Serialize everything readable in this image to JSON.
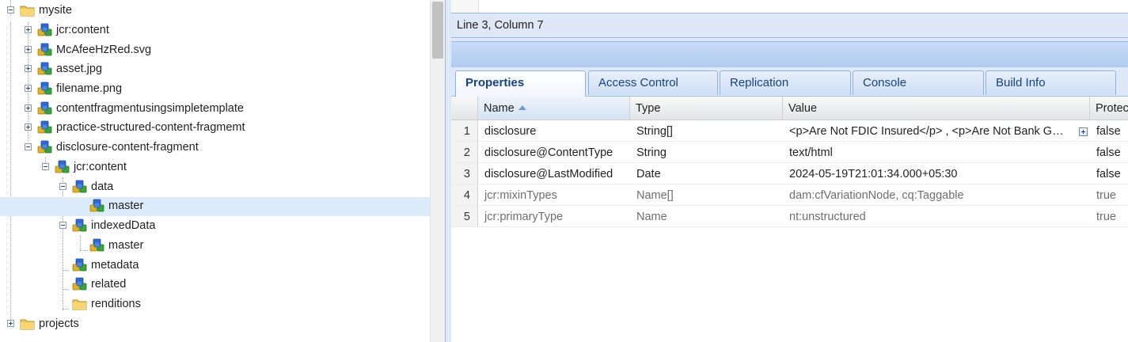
{
  "tree": {
    "nodes": [
      {
        "label": "mysite",
        "icon": "folder-icon",
        "toggle": "minus"
      },
      {
        "label": "jcr:content",
        "icon": "node-icon",
        "toggle": "plus"
      },
      {
        "label": "McAfeeHzRed.svg",
        "icon": "node-icon",
        "toggle": "plus"
      },
      {
        "label": "asset.jpg",
        "icon": "node-icon",
        "toggle": "plus"
      },
      {
        "label": "filename.png",
        "icon": "node-icon",
        "toggle": "plus"
      },
      {
        "label": "contentfragmentusingsimpletemplate",
        "icon": "node-icon",
        "toggle": "plus"
      },
      {
        "label": "practice-structured-content-fragmemt",
        "icon": "node-icon",
        "toggle": "plus"
      },
      {
        "label": "disclosure-content-fragment",
        "icon": "node-icon",
        "toggle": "minus"
      },
      {
        "label": "jcr:content",
        "icon": "node-icon",
        "toggle": "minus"
      },
      {
        "label": "data",
        "icon": "node-icon",
        "toggle": "minus"
      },
      {
        "label": "master",
        "icon": "node-icon",
        "toggle": "none",
        "selected": true
      },
      {
        "label": "indexedData",
        "icon": "node-icon",
        "toggle": "minus"
      },
      {
        "label": "master",
        "icon": "node-icon",
        "toggle": "none"
      },
      {
        "label": "metadata",
        "icon": "node-icon",
        "toggle": "none"
      },
      {
        "label": "related",
        "icon": "node-icon",
        "toggle": "none"
      },
      {
        "label": "renditions",
        "icon": "folder-icon",
        "toggle": "none"
      },
      {
        "label": "projects",
        "icon": "folder-icon",
        "toggle": "plus"
      }
    ]
  },
  "editor": {
    "status": "Line 3, Column 7"
  },
  "tabs": [
    {
      "label": "Properties",
      "active": true
    },
    {
      "label": "Access Control",
      "active": false
    },
    {
      "label": "Replication",
      "active": false
    },
    {
      "label": "Console",
      "active": false
    },
    {
      "label": "Build Info",
      "active": false
    }
  ],
  "grid": {
    "columns": [
      "Name",
      "Type",
      "Value",
      "Protec"
    ],
    "rows": [
      {
        "num": "1",
        "name": "disclosure",
        "type": "String[]",
        "value": "<p>Are Not FDIC Insured</p> , <p>Are Not Bank G…",
        "protected": "false",
        "expandable": true,
        "readonly": false
      },
      {
        "num": "2",
        "name": "disclosure@ContentType",
        "type": "String",
        "value": "text/html",
        "protected": "false",
        "expandable": false,
        "readonly": false
      },
      {
        "num": "3",
        "name": "disclosure@LastModified",
        "type": "Date",
        "value": "2024-05-19T21:01:34.000+05:30",
        "protected": "false",
        "expandable": false,
        "readonly": false
      },
      {
        "num": "4",
        "name": "jcr:mixinTypes",
        "type": "Name[]",
        "value": "dam:cfVariationNode, cq:Taggable",
        "protected": "true",
        "expandable": false,
        "readonly": true
      },
      {
        "num": "5",
        "name": "jcr:primaryType",
        "type": "Name",
        "value": "nt:unstructured",
        "protected": "true",
        "expandable": false,
        "readonly": true
      }
    ]
  },
  "colors": {
    "selection": "#dcebfa",
    "tab_text": "#15428b",
    "panel_bg": "#dfe8f6"
  }
}
